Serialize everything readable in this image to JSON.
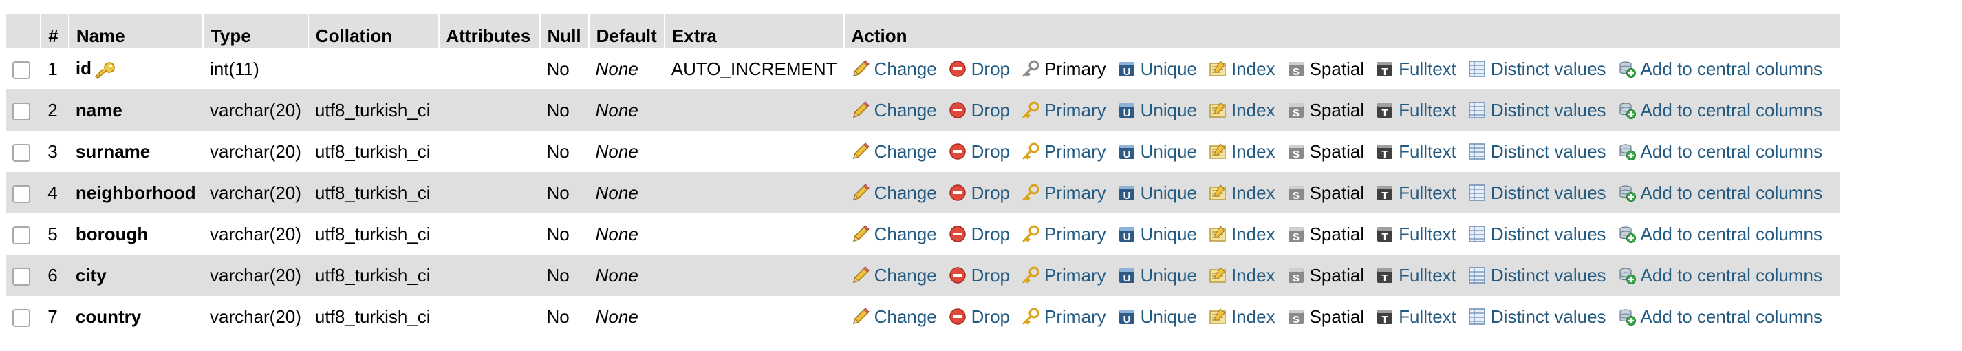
{
  "columns": [
    "",
    "#",
    "Name",
    "Type",
    "Collation",
    "Attributes",
    "Null",
    "Default",
    "Extra",
    "Action"
  ],
  "actions": {
    "change": "Change",
    "drop": "Drop",
    "primary": "Primary",
    "unique": "Unique",
    "index": "Index",
    "spatial": "Spatial",
    "fulltext": "Fulltext",
    "distinct": "Distinct values",
    "central": "Add to central columns"
  },
  "rows": [
    {
      "num": "1",
      "name": "id",
      "type": "int(11)",
      "collation": "",
      "attributes": "",
      "null": "No",
      "default": "None",
      "extra": "AUTO_INCREMENT",
      "primary_key": true
    },
    {
      "num": "2",
      "name": "name",
      "type": "varchar(20)",
      "collation": "utf8_turkish_ci",
      "attributes": "",
      "null": "No",
      "default": "None",
      "extra": "",
      "primary_key": false
    },
    {
      "num": "3",
      "name": "surname",
      "type": "varchar(20)",
      "collation": "utf8_turkish_ci",
      "attributes": "",
      "null": "No",
      "default": "None",
      "extra": "",
      "primary_key": false
    },
    {
      "num": "4",
      "name": "neighborhood",
      "type": "varchar(20)",
      "collation": "utf8_turkish_ci",
      "attributes": "",
      "null": "No",
      "default": "None",
      "extra": "",
      "primary_key": false
    },
    {
      "num": "5",
      "name": "borough",
      "type": "varchar(20)",
      "collation": "utf8_turkish_ci",
      "attributes": "",
      "null": "No",
      "default": "None",
      "extra": "",
      "primary_key": false
    },
    {
      "num": "6",
      "name": "city",
      "type": "varchar(20)",
      "collation": "utf8_turkish_ci",
      "attributes": "",
      "null": "No",
      "default": "None",
      "extra": "",
      "primary_key": false
    },
    {
      "num": "7",
      "name": "country",
      "type": "varchar(20)",
      "collation": "utf8_turkish_ci",
      "attributes": "",
      "null": "No",
      "default": "None",
      "extra": "",
      "primary_key": false
    }
  ],
  "colors": {
    "link": "#235a81",
    "header_bg": "#e0e0e0",
    "stripe": "#dfdfdf"
  }
}
